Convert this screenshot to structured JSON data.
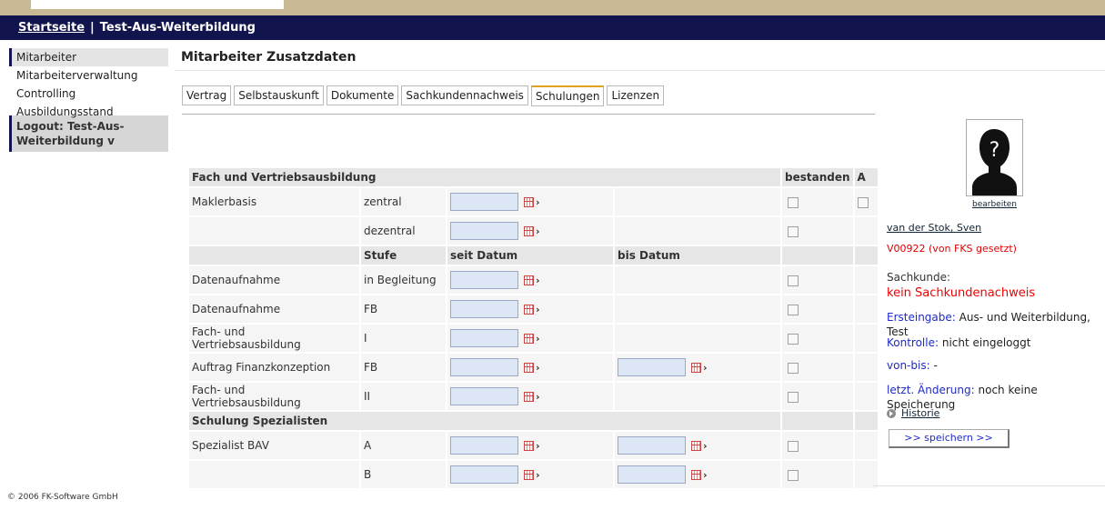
{
  "header": {
    "home_link": "Startseite",
    "separator": "|",
    "title": "Test-Aus-Weiterbildung"
  },
  "sidebar": {
    "items": [
      {
        "label": "Mitarbeiter"
      },
      {
        "label": "Mitarbeiterverwaltung"
      },
      {
        "label": "Controlling Ausbildungsstand"
      }
    ],
    "logout": "Logout: Test-Aus-Weiterbildung v"
  },
  "main": {
    "title": "Mitarbeiter Zusatzdaten",
    "tabs": [
      {
        "label": "Vertrag"
      },
      {
        "label": "Selbstauskunft"
      },
      {
        "label": "Dokumente"
      },
      {
        "label": "Sachkundennachweis"
      },
      {
        "label": "Schulungen",
        "active": true
      },
      {
        "label": "Lizenzen"
      }
    ]
  },
  "table": {
    "section1_title": "Fach und Vertriebsausbildung",
    "col_bestanden": "bestanden",
    "col_a": "A",
    "col_stufe": "Stufe",
    "col_seit": "seit Datum",
    "col_bis": "bis Datum",
    "rows": [
      {
        "name": "Maklerbasis",
        "stufe": "zentral"
      },
      {
        "name": "",
        "stufe": "dezentral"
      },
      {
        "name": "Datenaufnahme",
        "stufe": "in Begleitung"
      },
      {
        "name": "Datenaufnahme",
        "stufe": "FB"
      },
      {
        "name": "Fach- und Vertriebsausbildung",
        "stufe": "I"
      },
      {
        "name": "Auftrag Finanzkonzeption",
        "stufe": "FB"
      },
      {
        "name": "Fach- und Vertriebsausbildung",
        "stufe": "II"
      },
      {
        "name": "Spezialist BAV",
        "stufe": "A"
      },
      {
        "name": "",
        "stufe": "B"
      }
    ],
    "section2_title": "Schulung Spezialisten"
  },
  "right_panel": {
    "edit_link": "bearbeiten",
    "name": "van der Stok, Sven",
    "code": "V00922 (von FKS gesetzt)",
    "sachkunde_label": "Sachkunde:",
    "sachkunde_value": "kein Sachkundenachweis",
    "ersteingabe_key": "Ersteingabe:",
    "ersteingabe_val": "Aus- und Weiterbildung, Test",
    "kontrolle_key": "Kontrolle:",
    "kontrolle_val": "nicht eingeloggt",
    "vonbis_key": "von-bis:",
    "vonbis_val": "-",
    "aenderung_key": "letzt. Änderung:",
    "aenderung_val": "noch keine Speicherung",
    "historie": "Historie",
    "save_button": ">> speichern >>"
  },
  "footer": {
    "copyright": "© 2006 FK-Software GmbH"
  },
  "colors": {
    "header_bg": "#12154d",
    "accent_tab": "#e0a020",
    "link_blue": "#1f2ac9",
    "error_red": "#e00000"
  }
}
